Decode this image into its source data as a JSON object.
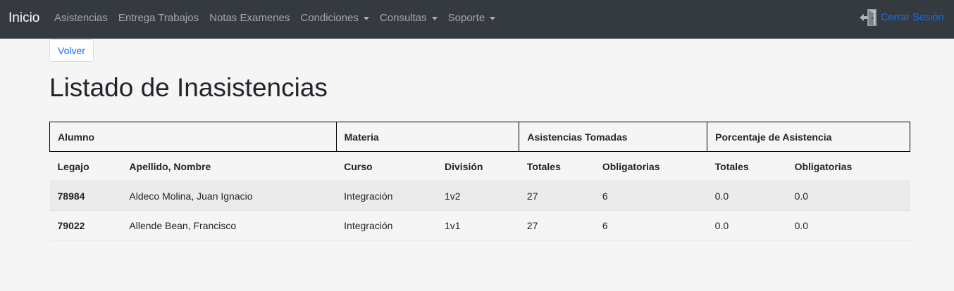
{
  "navbar": {
    "brand": "Inicio",
    "links": [
      {
        "label": "Asistencias",
        "dropdown": false
      },
      {
        "label": "Entrega Trabajos",
        "dropdown": false
      },
      {
        "label": "Notas Examenes",
        "dropdown": false
      },
      {
        "label": "Condiciones",
        "dropdown": true
      },
      {
        "label": "Consultas",
        "dropdown": true
      },
      {
        "label": "Soporte",
        "dropdown": true
      }
    ],
    "logout_label": "Cerrar Sesión",
    "logout_icon": "exit-door-icon"
  },
  "back_button": "Volver",
  "page_title": "Listado de Inasistencias",
  "table": {
    "groups": [
      "Alumno",
      "Materia",
      "Asistencias Tomadas",
      "Porcentaje de Asistencia"
    ],
    "columns": [
      "Legajo",
      "Apellido, Nombre",
      "Curso",
      "División",
      "Totales",
      "Obligatorias",
      "Totales",
      "Obligatorias"
    ],
    "rows": [
      [
        "78984",
        "Aldeco Molina, Juan Ignacio",
        "Integración",
        "1v2",
        "27",
        "6",
        "0.0",
        "0.0"
      ],
      [
        "79022",
        "Allende Bean, Francisco",
        "Integración",
        "1v1",
        "27",
        "6",
        "0.0",
        "0.0"
      ]
    ]
  },
  "colors": {
    "navbar_bg": "#343a40",
    "link_accent": "#0d6efd",
    "page_bg": "#f5f5f5"
  }
}
